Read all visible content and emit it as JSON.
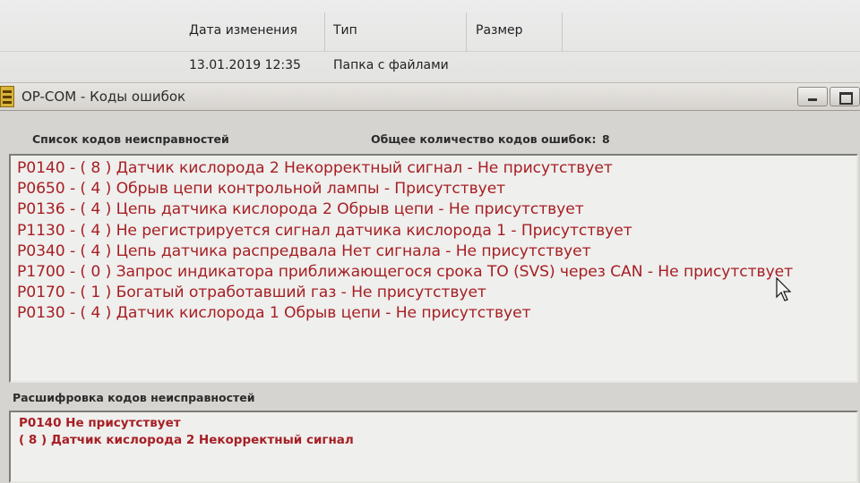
{
  "explorer": {
    "col_date": "Дата изменения",
    "col_type": "Тип",
    "col_size": "Размер",
    "row_date": "13.01.2019 12:35",
    "row_type": "Папка с файлами"
  },
  "window": {
    "title": "OP-COM - Коды ошибок"
  },
  "fault_list": {
    "header": "Список кодов неисправностей",
    "total_label": "Общее количество кодов ошибок:",
    "total_value": "8",
    "items": [
      "P0140 - ( 8 )  Датчик кислорода 2 Некорректный сигнал - Не присутствует",
      "P0650 - ( 4 )  Обрыв цепи контрольной лампы  - Присутствует",
      "P0136 - ( 4 )  Цепь датчика кислорода 2 Обрыв цепи  - Не присутствует",
      "P1130 - ( 4 )  Не регистрируется сигнал датчика кислорода 1 - Присутствует",
      "P0340 - ( 4 )  Цепь датчика распредвала Нет сигнала - Не присутствует",
      "P1700 - ( 0 )  Запрос индикатора приближающегося срока ТО (SVS) через CAN - Не присутствует",
      "P0170 - ( 1 )  Богатый отработавший газ  - Не присутствует",
      "P0130 - ( 4 )  Датчик кислорода 1 Обрыв цепи  - Не присутствует"
    ]
  },
  "decode": {
    "header": "Расшифровка кодов неисправностей",
    "line1": "P0140  Не присутствует",
    "line2": "( 8 )  Датчик кислорода 2 Некорректный сигнал"
  },
  "colors": {
    "fault_text": "#a61f24",
    "panel_bg": "#efefed",
    "window_bg": "#d5d4d0"
  }
}
